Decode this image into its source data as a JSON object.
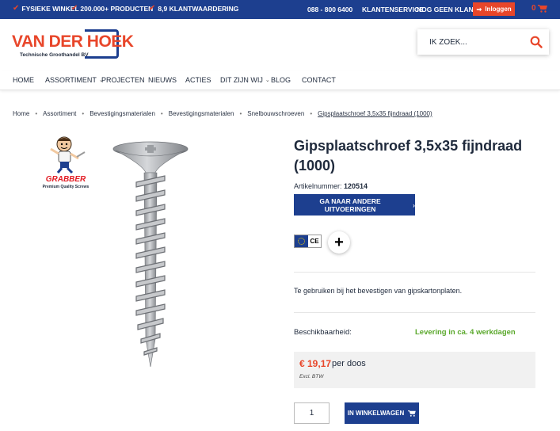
{
  "topbar": {
    "usps": [
      "FYSIEKE WINKEL",
      "200.000+ PRODUCTEN",
      "8,9 KLANTWAARDERING"
    ],
    "phone": "088 - 800 6400",
    "service": "KLANTENSERVICE",
    "new_customer": "NOG GEEN KLANT?",
    "login_label": "Inloggen",
    "cart_count": "0"
  },
  "header": {
    "logo_text": "VAN DER HOEK",
    "logo_sub": "Technische Groothandel BV",
    "search_placeholder": "IK ZOEK..."
  },
  "nav": [
    "HOME",
    "ASSORTIMENT",
    "PROJECTEN",
    "NIEUWS",
    "ACTIES",
    "DIT ZIJN WIJ",
    "BLOG",
    "CONTACT"
  ],
  "breadcrumb": [
    "Home",
    "Assortiment",
    "Bevestigingsmaterialen",
    "Bevestigingsmaterialen",
    "Snelbouwschroeven",
    "Gipsplaatschroef 3,5x35 fijndraad (1000)"
  ],
  "brand": {
    "name": "GRABBER",
    "tagline": "Premium Quality Screws"
  },
  "product": {
    "title": "Gipsplaatschroef 3,5x35 fijndraad (1000)",
    "article_label": "Artikelnummer:",
    "article_number": "120514",
    "variants_button": "GA NAAR ANDERE UITVOERINGEN",
    "ce_label": "CE",
    "description": "Te gebruiken bij het bevestigen van gipskartonplaten.",
    "availability_label": "Beschikbaarheid:",
    "availability_value": "Levering in ca. 4 werkdagen",
    "price": "€ 19,17",
    "price_unit": "per doos",
    "price_note": "Excl. BTW",
    "quantity": "1",
    "add_to_cart": "IN WINKELWAGEN"
  },
  "colors": {
    "brand_blue": "#1d3f8f",
    "accent_orange": "#e8462a",
    "availability_green": "#5aa82b"
  }
}
